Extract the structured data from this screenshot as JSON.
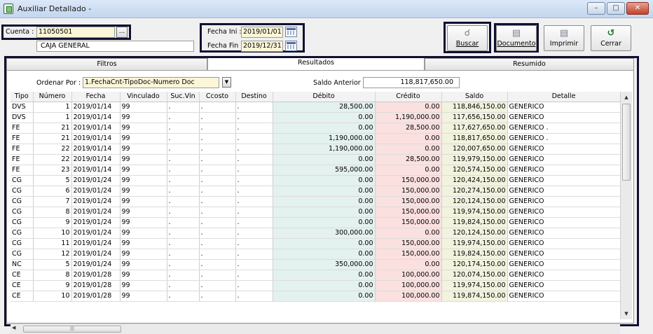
{
  "window": {
    "title": "Auxiliar Detallado -",
    "btn_min": "–",
    "btn_max": "□",
    "btn_close": "✕"
  },
  "cuenta": {
    "label": "Cuenta :",
    "code": "11050501",
    "browse": "...",
    "name": "CAJA GENERAL"
  },
  "fechas": {
    "ini_label": "Fecha Ini :",
    "ini_value": "2019/01/01",
    "fin_label": "Fecha Fin :",
    "fin_value": "2019/12/31"
  },
  "toolbar": {
    "buscar": "Buscar",
    "documento": "Documento",
    "imprimir": "Imprimir",
    "cerrar": "Cerrar"
  },
  "tabs": {
    "filtros": "Filtros",
    "resultados": "Resultados",
    "resumido": "Resumido"
  },
  "orden": {
    "label": "Ordenar Por :",
    "value": "1.FechaCnt-TipoDoc-Numero Doc"
  },
  "saldo_anterior": {
    "label": "Saldo Anterior",
    "value": "118,817,650.00"
  },
  "columns": [
    "Tipo",
    "Número",
    "Fecha",
    "Vinculado",
    "Suc.Vin",
    "Ccosto",
    "Destino",
    "Débito",
    "Crédito",
    "Saldo",
    "Detalle"
  ],
  "rows": [
    [
      "DVS",
      "1",
      "2019/01/14",
      "99",
      ".",
      ".",
      ".",
      "28,500.00",
      "0.00",
      "118,846,150.00",
      "GENERICO"
    ],
    [
      "DVS",
      "1",
      "2019/01/14",
      "99",
      ".",
      ".",
      ".",
      "0.00",
      "1,190,000.00",
      "117,656,150.00",
      "GENERICO"
    ],
    [
      "FE",
      "21",
      "2019/01/14",
      "99",
      ".",
      ".",
      ".",
      "0.00",
      "28,500.00",
      "117,627,650.00",
      "GENERICO ."
    ],
    [
      "FE",
      "21",
      "2019/01/14",
      "99",
      ".",
      ".",
      ".",
      "1,190,000.00",
      "0.00",
      "118,817,650.00",
      "GENERICO ."
    ],
    [
      "FE",
      "22",
      "2019/01/14",
      "99",
      ".",
      ".",
      ".",
      "1,190,000.00",
      "0.00",
      "120,007,650.00",
      "GENERICO"
    ],
    [
      "FE",
      "22",
      "2019/01/14",
      "99",
      ".",
      ".",
      ".",
      "0.00",
      "28,500.00",
      "119,979,150.00",
      "GENERICO"
    ],
    [
      "FE",
      "23",
      "2019/01/14",
      "99",
      ".",
      ".",
      ".",
      "595,000.00",
      "0.00",
      "120,574,150.00",
      "GENERICO"
    ],
    [
      "CG",
      "5",
      "2019/01/24",
      "99",
      ".",
      ".",
      ".",
      "0.00",
      "150,000.00",
      "120,424,150.00",
      "GENERICO"
    ],
    [
      "CG",
      "6",
      "2019/01/24",
      "99",
      ".",
      ".",
      ".",
      "0.00",
      "150,000.00",
      "120,274,150.00",
      "GENERICO"
    ],
    [
      "CG",
      "7",
      "2019/01/24",
      "99",
      ".",
      ".",
      ".",
      "0.00",
      "150,000.00",
      "120,124,150.00",
      "GENERICO"
    ],
    [
      "CG",
      "8",
      "2019/01/24",
      "99",
      ".",
      ".",
      ".",
      "0.00",
      "150,000.00",
      "119,974,150.00",
      "GENERICO"
    ],
    [
      "CG",
      "9",
      "2019/01/24",
      "99",
      ".",
      ".",
      ".",
      "0.00",
      "150,000.00",
      "119,824,150.00",
      "GENERICO"
    ],
    [
      "CG",
      "10",
      "2019/01/24",
      "99",
      ".",
      ".",
      ".",
      "300,000.00",
      "0.00",
      "120,124,150.00",
      "GENERICO"
    ],
    [
      "CG",
      "11",
      "2019/01/24",
      "99",
      ".",
      ".",
      ".",
      "0.00",
      "150,000.00",
      "119,974,150.00",
      "GENERICO"
    ],
    [
      "CG",
      "12",
      "2019/01/24",
      "99",
      ".",
      ".",
      ".",
      "0.00",
      "150,000.00",
      "119,824,150.00",
      "GENERICO"
    ],
    [
      "NC",
      "5",
      "2019/01/24",
      "99",
      ".",
      ".",
      ".",
      "350,000.00",
      "0.00",
      "120,174,150.00",
      "GENERICO"
    ],
    [
      "CE",
      "8",
      "2019/01/28",
      "99",
      ".",
      ".",
      ".",
      "0.00",
      "100,000.00",
      "120,074,150.00",
      "GENERICO"
    ],
    [
      "CE",
      "9",
      "2019/01/28",
      "99",
      ".",
      ".",
      ".",
      "0.00",
      "100,000.00",
      "119,974,150.00",
      "GENERICO"
    ],
    [
      "CE",
      "10",
      "2019/01/28",
      "99",
      ".",
      ".",
      ".",
      "0.00",
      "100,000.00",
      "119,874,150.00",
      "GENERICO"
    ]
  ],
  "icons": {
    "buscar": "magnifier-icon",
    "documento": "document-icon",
    "imprimir": "printer-icon",
    "cerrar": "undo-arrow-icon"
  },
  "colors": {
    "debito_bg": "#e3f1ef",
    "credito_bg": "#fbe0e0",
    "saldo_bg": "#f2f3de",
    "highlight": "#101030"
  }
}
